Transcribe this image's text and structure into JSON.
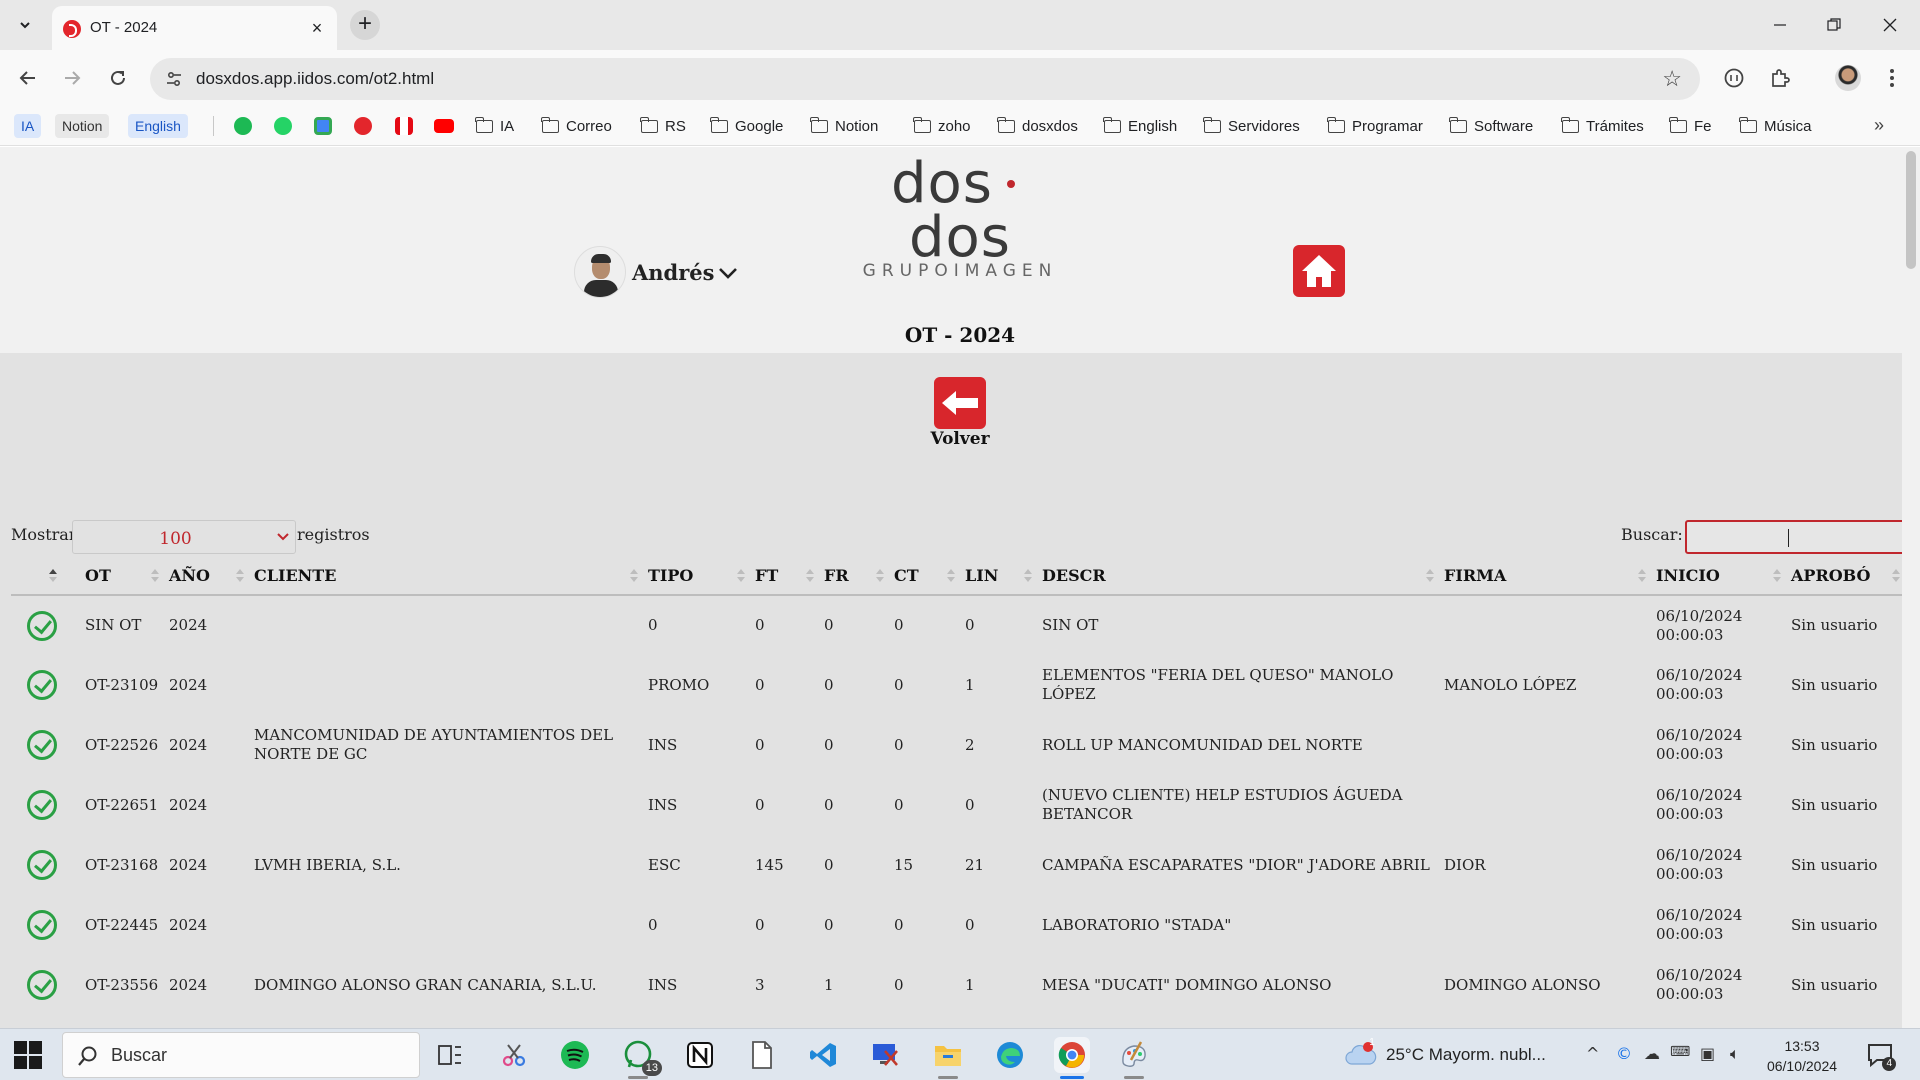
{
  "browser": {
    "tab_title": "OT - 2024",
    "url": "dosxdos.app.iidos.com/ot2.html",
    "bookmark_chips": [
      "IA",
      "Notion",
      "English"
    ],
    "bookmark_folders": [
      "IA",
      "Correo",
      "RS",
      "Google",
      "Notion",
      "zoho",
      "dosxdos",
      "English",
      "Servidores",
      "Programar",
      "Software",
      "Trámites",
      "Fe",
      "Música"
    ]
  },
  "header": {
    "logo_main_left": "dos",
    "logo_main_right": "dos",
    "logo_sub": "GRUPOIMAGEN",
    "user_name": "Andrés",
    "page_title": "OT - 2024",
    "back_label": "Volver"
  },
  "controls": {
    "show_label": "Mostrar",
    "show_value": "100",
    "records_label": "registros",
    "search_label": "Buscar:"
  },
  "table": {
    "columns": [
      "",
      "OT",
      "AÑO",
      "CLIENTE",
      "TIPO",
      "FT",
      "FR",
      "CT",
      "LIN",
      "DESCR",
      "FIRMA",
      "INICIO",
      "APROBÓ"
    ],
    "rows": [
      {
        "ot": "SIN OT",
        "anio": "2024",
        "cliente": "",
        "tipo": "0",
        "ft": "0",
        "fr": "0",
        "ct": "0",
        "lin": "0",
        "descr": "SIN OT",
        "firma": "",
        "inicio": "06/10/2024 00:00:03",
        "aprobo": "Sin usuario"
      },
      {
        "ot": "OT-23109",
        "anio": "2024",
        "cliente": "",
        "tipo": "PROMO",
        "ft": "0",
        "fr": "0",
        "ct": "0",
        "lin": "1",
        "descr": "ELEMENTOS \"FERIA DEL QUESO\" MANOLO LÓPEZ",
        "firma": "MANOLO LÓPEZ",
        "inicio": "06/10/2024 00:00:03",
        "aprobo": "Sin usuario"
      },
      {
        "ot": "OT-22526",
        "anio": "2024",
        "cliente": "MANCOMUNIDAD DE AYUNTAMIENTOS DEL NORTE DE GC",
        "tipo": "INS",
        "ft": "0",
        "fr": "0",
        "ct": "0",
        "lin": "2",
        "descr": "ROLL UP MANCOMUNIDAD DEL NORTE",
        "firma": "",
        "inicio": "06/10/2024 00:00:03",
        "aprobo": "Sin usuario"
      },
      {
        "ot": "OT-22651",
        "anio": "2024",
        "cliente": "",
        "tipo": "INS",
        "ft": "0",
        "fr": "0",
        "ct": "0",
        "lin": "0",
        "descr": "(NUEVO CLIENTE) HELP ESTUDIOS ÁGUEDA BETANCOR",
        "firma": "",
        "inicio": "06/10/2024 00:00:03",
        "aprobo": "Sin usuario"
      },
      {
        "ot": "OT-23168",
        "anio": "2024",
        "cliente": "LVMH IBERIA, S.L.",
        "tipo": "ESC",
        "ft": "145",
        "fr": "0",
        "ct": "15",
        "lin": "21",
        "descr": "CAMPAÑA ESCAPARATES \"DIOR\" J'ADORE ABRIL",
        "firma": "DIOR",
        "inicio": "06/10/2024 00:00:03",
        "aprobo": "Sin usuario"
      },
      {
        "ot": "OT-22445",
        "anio": "2024",
        "cliente": "",
        "tipo": "0",
        "ft": "0",
        "fr": "0",
        "ct": "0",
        "lin": "0",
        "descr": "LABORATORIO \"STADA\"",
        "firma": "",
        "inicio": "06/10/2024 00:00:03",
        "aprobo": "Sin usuario"
      },
      {
        "ot": "OT-23556",
        "anio": "2024",
        "cliente": "DOMINGO ALONSO GRAN CANARIA, S.L.U.",
        "tipo": "INS",
        "ft": "3",
        "fr": "1",
        "ct": "0",
        "lin": "1",
        "descr": "MESA \"DUCATI\" DOMINGO ALONSO",
        "firma": "DOMINGO ALONSO",
        "inicio": "06/10/2024 00:00:03",
        "aprobo": "Sin usuario"
      }
    ]
  },
  "taskbar": {
    "search_placeholder": "Buscar",
    "whatsapp_badge": "13",
    "weather_badge": "1",
    "weather": "25°C  Mayorm. nubl...",
    "time": "13:53",
    "date": "06/10/2024",
    "notifications": "4"
  },
  "colors": {
    "brand_red": "#d8262c",
    "positive_green": "#2c9a3c",
    "zero_red": "#e0302f"
  }
}
